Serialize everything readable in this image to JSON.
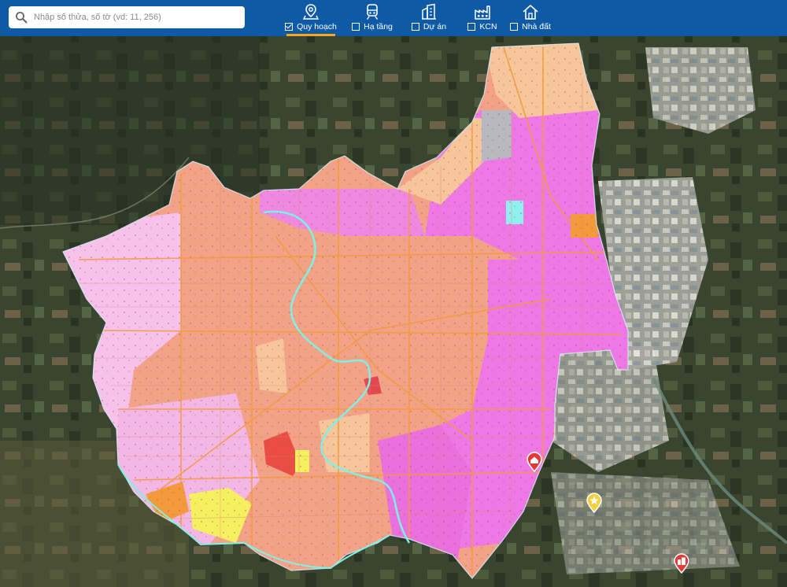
{
  "search": {
    "placeholder": "Nhập số thửa, số tờ (vd: 11, 256)"
  },
  "layers": [
    {
      "label": "Quy hoạch",
      "icon": "map-pin-icon",
      "checked": true,
      "active": true
    },
    {
      "label": "Hạ tầng",
      "icon": "train-icon",
      "checked": false,
      "active": false
    },
    {
      "label": "Dự án",
      "icon": "buildings-icon",
      "checked": false,
      "active": false
    },
    {
      "label": "KCN",
      "icon": "factory-icon",
      "checked": false,
      "active": false
    },
    {
      "label": "Nhà đất",
      "icon": "house-icon",
      "checked": false,
      "active": false
    }
  ],
  "colors": {
    "header": "#0e5aa7",
    "active_underline": "#f5a623",
    "residential": "#f2a387",
    "urban_mixed": "#ee79e6",
    "light_pink": "#f6c2ec",
    "peach": "#f6c59a",
    "orange_road": "#f39a3c",
    "river_outline": "#7ff0e6",
    "commercial_red": "#ea4d43",
    "yellow_zone": "#f5f060",
    "marker_red": "#e53935",
    "marker_yellow": "#f4d03f"
  },
  "map_markers": [
    {
      "name": "real-estate-marker",
      "icon": "house-icon",
      "color": "red"
    },
    {
      "name": "featured-project-marker",
      "icon": "star-icon",
      "color": "yellow"
    },
    {
      "name": "project-marker",
      "icon": "buildings-icon",
      "color": "red"
    }
  ]
}
